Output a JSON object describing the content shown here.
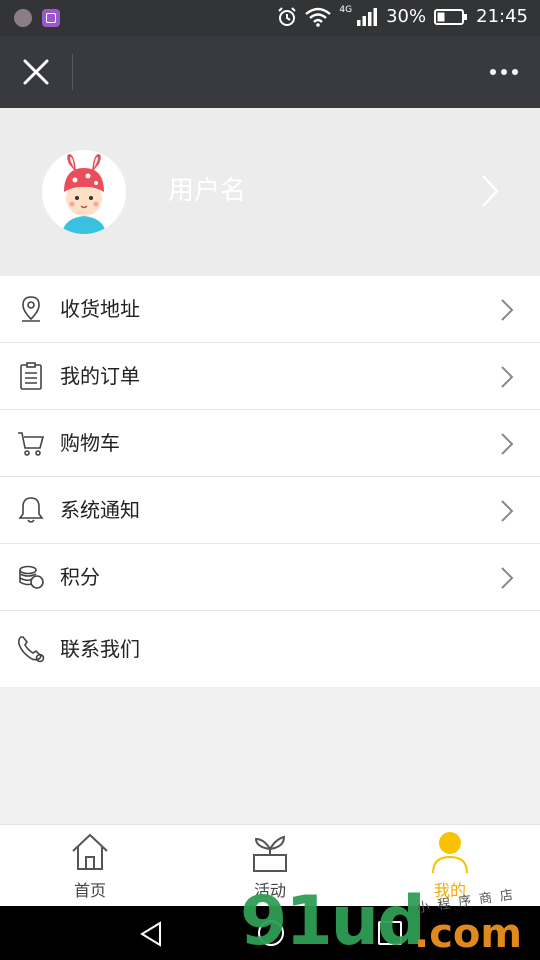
{
  "status_bar": {
    "network": "4G",
    "battery": "30%",
    "time": "21:45"
  },
  "title_bar": {
    "close_icon": "close-icon",
    "more_icon": "more-icon"
  },
  "profile": {
    "username": "用户名",
    "avatar_icon": "avatar-kid-bunny-hat"
  },
  "menu": {
    "items": [
      {
        "label": "收货地址",
        "icon": "location-pin-icon"
      },
      {
        "label": "我的订单",
        "icon": "clipboard-icon"
      },
      {
        "label": "购物车",
        "icon": "cart-icon"
      },
      {
        "label": "系统通知",
        "icon": "bell-icon"
      },
      {
        "label": "积分",
        "icon": "coins-icon"
      },
      {
        "label": "联系我们",
        "icon": "phone-icon"
      }
    ]
  },
  "tabs": [
    {
      "label": "首页",
      "icon": "home-icon"
    },
    {
      "label": "活动",
      "icon": "plant-icon"
    },
    {
      "label": "我的",
      "icon": "user-icon",
      "active": true
    }
  ],
  "watermark": {
    "main": "91ud",
    "suffix": ".com",
    "tag": "小程序商店"
  },
  "colors": {
    "status_bar": "#333436",
    "title_bar": "#393a3f",
    "active_tab": "#f0ac00",
    "page_bg": "#f0f0f0"
  }
}
